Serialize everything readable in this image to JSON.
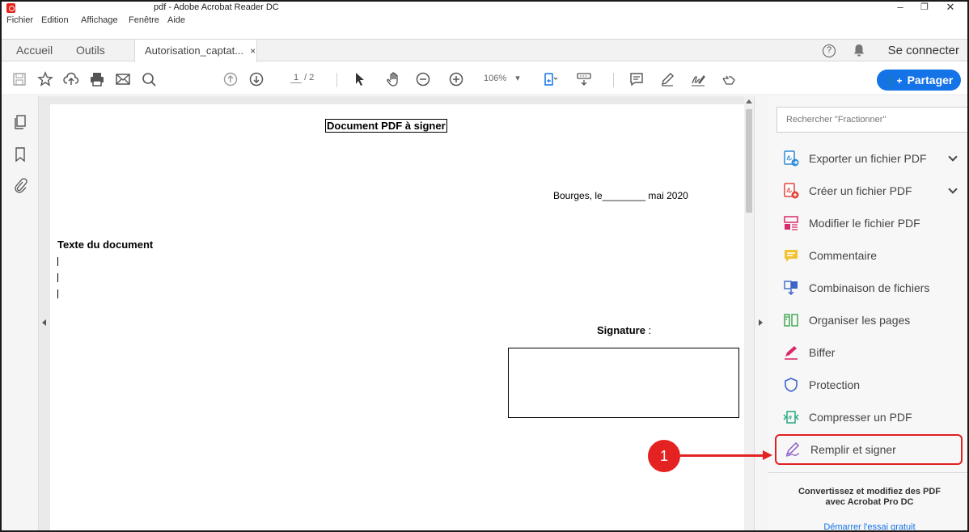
{
  "window": {
    "title": "pdf - Adobe Acrobat Reader DC",
    "controls": {
      "minimize": "–",
      "maximize": "❐",
      "close": "✕"
    }
  },
  "menu": [
    "Fichier",
    "Edition",
    "Affichage",
    "Fenêtre",
    "Aide"
  ],
  "tabs": {
    "home": "Accueil",
    "tools": "Outils",
    "document": "Autorisation_captat...",
    "close": "×",
    "help": "?",
    "signin": "Se connecter"
  },
  "toolbar": {
    "page_current": "1",
    "page_total": "/ 2",
    "zoom": "106%",
    "zoom_arrow": "▾",
    "share_label": "Partager",
    "share_icon": "👤+"
  },
  "document": {
    "title": "Document PDF à signer",
    "date_line": "Bourges, le________ mai 2020",
    "body_label": "Texte du document",
    "signature_label": "Signature",
    "signature_colon": " :"
  },
  "right_panel": {
    "search_placeholder": "Rechercher \"Fractionner\"",
    "tools": [
      {
        "label": "Exporter un fichier PDF",
        "icon": "export-pdf-icon",
        "expandable": true
      },
      {
        "label": "Créer un fichier PDF",
        "icon": "create-pdf-icon",
        "expandable": true
      },
      {
        "label": "Modifier le fichier PDF",
        "icon": "edit-pdf-icon",
        "expandable": false
      },
      {
        "label": "Commentaire",
        "icon": "comment-icon",
        "expandable": false
      },
      {
        "label": "Combinaison de fichiers",
        "icon": "combine-files-icon",
        "expandable": false
      },
      {
        "label": "Organiser les pages",
        "icon": "organize-pages-icon",
        "expandable": false
      },
      {
        "label": "Biffer",
        "icon": "redact-icon",
        "expandable": false
      },
      {
        "label": "Protection",
        "icon": "shield-icon",
        "expandable": false
      },
      {
        "label": "Compresser un PDF",
        "icon": "compress-pdf-icon",
        "expandable": false
      },
      {
        "label": "Remplir et signer",
        "icon": "fill-sign-icon",
        "expandable": false,
        "highlighted": true
      }
    ],
    "promo_text": "Convertissez et modifiez des PDF avec Acrobat Pro DC",
    "promo_link": "Démarrer l'essai gratuit"
  },
  "annotation": {
    "number": "1",
    "color": "#e52222"
  },
  "colors": {
    "accent": "#1473e6",
    "highlight": "#e02020"
  }
}
